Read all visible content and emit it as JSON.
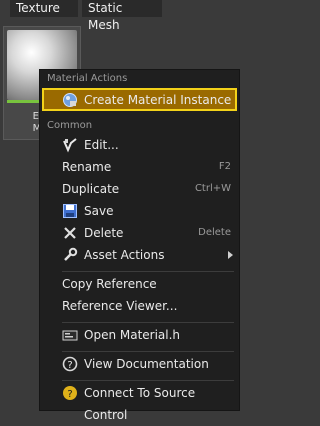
{
  "tabs": [
    "Texture",
    "Static Mesh"
  ],
  "asset_thumbnail": {
    "label_line1": "Emi",
    "label_line2": "Mat"
  },
  "context_menu": {
    "section_material_actions": "Material Actions",
    "create_material_instance": "Create Material Instance",
    "section_common": "Common",
    "edit": "Edit...",
    "rename": "Rename",
    "rename_shortcut": "F2",
    "duplicate": "Duplicate",
    "duplicate_shortcut": "Ctrl+W",
    "save": "Save",
    "delete": "Delete",
    "delete_shortcut": "Delete",
    "asset_actions": "Asset Actions",
    "copy_reference": "Copy Reference",
    "reference_viewer": "Reference Viewer...",
    "open_material_h": "Open Material.h",
    "view_documentation": "View Documentation",
    "connect_to_source_control": "Connect To Source Control"
  },
  "colors": {
    "menu_background": "#1f1f1f",
    "highlight_border": "#f3d21a",
    "highlight_fill": "#9a6a00",
    "thumbnail_accent": "#78c33e"
  }
}
